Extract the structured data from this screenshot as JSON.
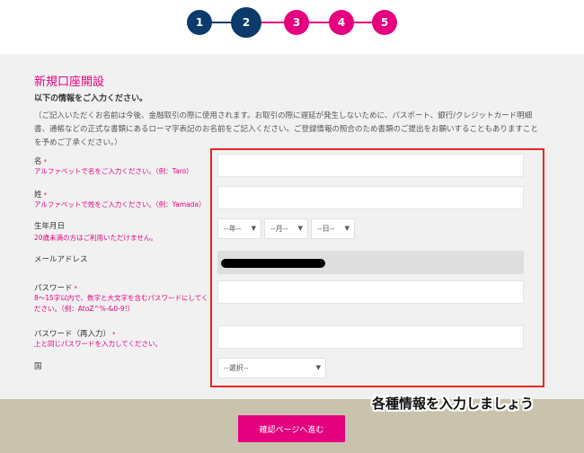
{
  "stepper": {
    "steps": [
      "1",
      "2",
      "3",
      "4",
      "5"
    ],
    "current": 2,
    "done_color": "#0b3a6b",
    "todo_color": "#e5007f"
  },
  "form": {
    "title": "新規口座開設",
    "subtitle": "以下の情報をご入力ください。",
    "notice": "（ご記入いただくお名前は今後、金融取引の際に使用されます。お取引の際に遅延が発生しないために、パスポート、銀行/クレジットカード明細書、通帳などの正式な書類にあるローマ字表記のお名前をご記入ください。ご登録情報の照合のため書類のご提出をお願いすることもありますことを予めご了承ください。）",
    "fields": {
      "first_name": {
        "label": "名",
        "required_mark": "*",
        "hint": "アルファベットで名をご入力ください。（例：Taro）",
        "value": ""
      },
      "last_name": {
        "label": "姓",
        "required_mark": "*",
        "hint": "アルファベットで姓をご入力ください。（例：Yamada）",
        "value": ""
      },
      "birthdate": {
        "label": "生年月日",
        "hint": "20歳未満の方はご利用いただけません。",
        "year": "--年--",
        "month": "--月--",
        "day": "--日--"
      },
      "email": {
        "label": "メールアドレス"
      },
      "password": {
        "label": "パスワード",
        "required_mark": "*",
        "hint": "8～15字以内で、数字と大文字を含むパスワードにしてください。（例：AtoZ^%-&0-9!）",
        "value": ""
      },
      "password_confirm": {
        "label": "パスワード（再入力）",
        "required_mark": "*",
        "hint": "上と同じパスワードを入力してください。",
        "value": ""
      },
      "country": {
        "label": "国",
        "selected": "--選択--"
      }
    },
    "confirm_label": "確認ページへ進む"
  },
  "caption": "各種情報を入力しましょう",
  "colors": {
    "accent": "#e5007f",
    "highlight": "#e8281e",
    "footer": "#c9c3ae"
  }
}
